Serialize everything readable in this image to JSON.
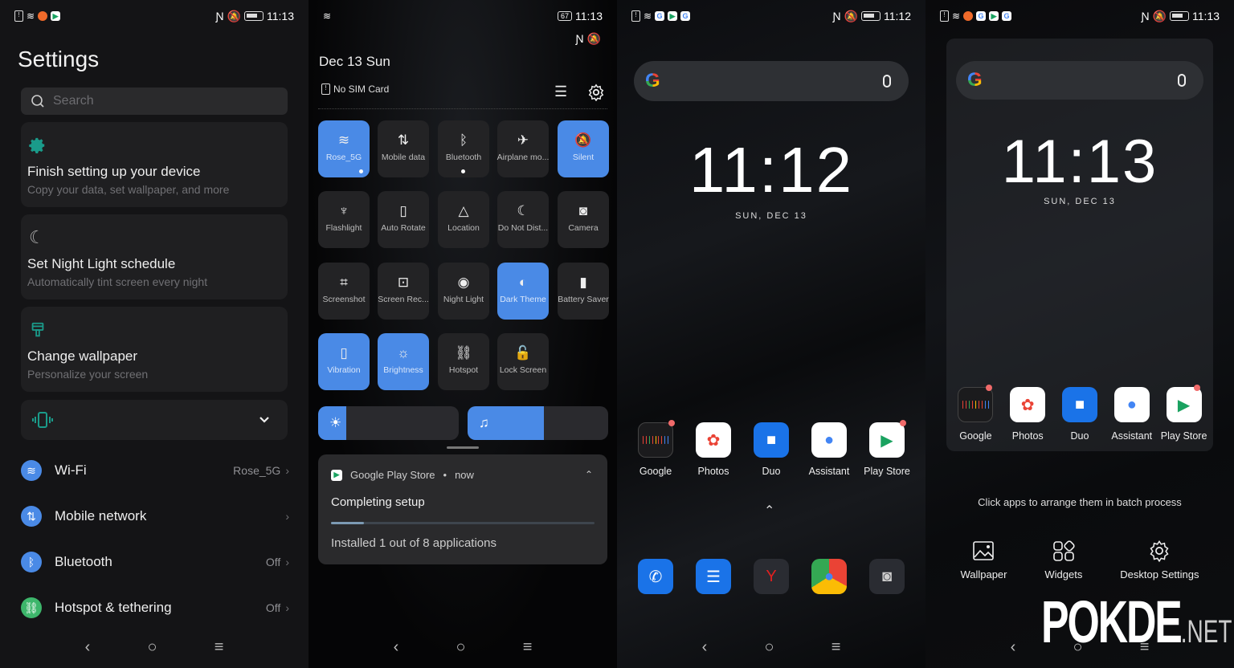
{
  "panel1": {
    "status": {
      "time": "11:13"
    },
    "title": "Settings",
    "search": {
      "placeholder": "Search"
    },
    "cards": [
      {
        "title": "Finish setting up your device",
        "subtitle": "Copy your data, set wallpaper, and more",
        "icon": "gear-icon"
      },
      {
        "title": "Set Night Light schedule",
        "subtitle": "Automatically tint screen every night",
        "icon": "moon-icon"
      },
      {
        "title": "Change wallpaper",
        "subtitle": "Personalize your screen",
        "icon": "brush-icon"
      }
    ],
    "rows": [
      {
        "label": "Wi-Fi",
        "value": "Rose_5G",
        "color": "#4a8ae6"
      },
      {
        "label": "Mobile network",
        "value": "",
        "color": "#4a8ae6"
      },
      {
        "label": "Bluetooth",
        "value": "Off",
        "color": "#4a8ae6"
      },
      {
        "label": "Hotspot & tethering",
        "value": "Off",
        "color": "#3db66b"
      }
    ],
    "accent": "#1a9b8a"
  },
  "panel2": {
    "status": {
      "time": "11:13",
      "battery": "67"
    },
    "date": "Dec 13  Sun",
    "sim": "No SIM Card",
    "tiles": [
      {
        "label": "Rose_5G",
        "on": true,
        "icon": "≋"
      },
      {
        "label": "Mobile data",
        "on": false,
        "icon": "⇅"
      },
      {
        "label": "Bluetooth",
        "on": false,
        "icon": "ᛒ"
      },
      {
        "label": "Airplane mo...",
        "on": false,
        "icon": "✈"
      },
      {
        "label": "Silent",
        "on": true,
        "icon": "🔕"
      },
      {
        "label": "Flashlight",
        "on": false,
        "icon": "♆"
      },
      {
        "label": "Auto Rotate",
        "on": false,
        "icon": "▯"
      },
      {
        "label": "Location",
        "on": false,
        "icon": "△"
      },
      {
        "label": "Do Not Dist...",
        "on": false,
        "icon": "☾"
      },
      {
        "label": "Camera",
        "on": false,
        "icon": "◙"
      },
      {
        "label": "Screenshot",
        "on": false,
        "icon": "⌗"
      },
      {
        "label": "Screen Rec...",
        "on": false,
        "icon": "⊡"
      },
      {
        "label": "Night Light",
        "on": false,
        "icon": "◉"
      },
      {
        "label": "Dark Theme",
        "on": true,
        "icon": "◐"
      },
      {
        "label": "Battery Saver",
        "on": false,
        "icon": "▮"
      },
      {
        "label": "Vibration",
        "on": true,
        "icon": "▯"
      },
      {
        "label": "Brightness",
        "on": true,
        "icon": "☼"
      },
      {
        "label": "Hotspot",
        "on": false,
        "icon": "⛓"
      },
      {
        "label": "Lock Screen",
        "on": false,
        "icon": "🔓"
      }
    ],
    "brightness_level": 0.2,
    "volume_level": 0.54,
    "notification": {
      "app": "Google Play Store",
      "time": "now",
      "title": "Completing setup",
      "message": "Installed 1 out of 8 applications",
      "progress": 0.125
    }
  },
  "panel3": {
    "status": {
      "time": "11:12"
    },
    "clock": "11:12",
    "date": "SUN, DEC 13",
    "apps": [
      "Google",
      "Photos",
      "Duo",
      "Assistant",
      "Play Store"
    ],
    "dock": [
      "Phone",
      "Messages",
      "Game Space",
      "Chrome",
      "Camera"
    ]
  },
  "panel4": {
    "status": {
      "time": "11:13"
    },
    "clock": "11:13",
    "date": "SUN, DEC 13",
    "apps": [
      "Google",
      "Photos",
      "Duo",
      "Assistant",
      "Play Store"
    ],
    "hint": "Click apps to arrange them in batch process",
    "options": [
      "Wallpaper",
      "Widgets",
      "Desktop Settings"
    ]
  },
  "watermark": {
    "brand": "POKDE",
    "suffix": ".NET"
  }
}
